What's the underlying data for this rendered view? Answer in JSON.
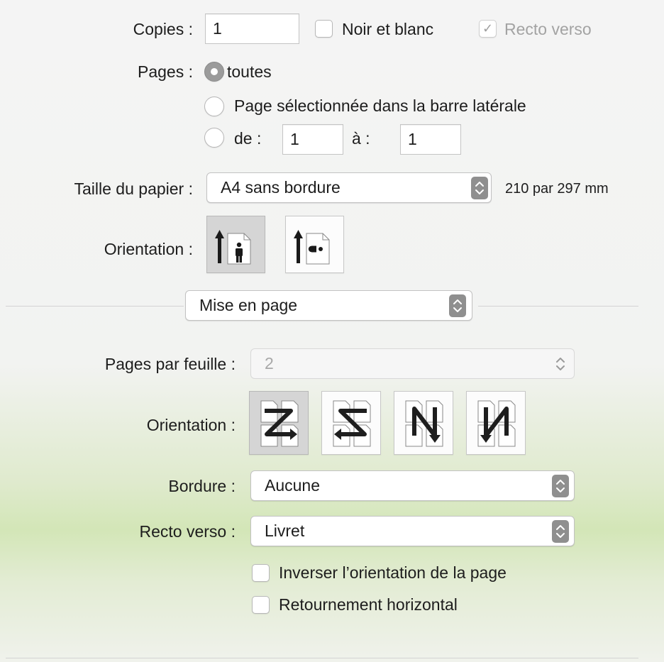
{
  "copies": {
    "label": "Copies :",
    "value": "1"
  },
  "noir_et_blanc": {
    "label": "Noir et blanc",
    "checked": false
  },
  "recto_verso_top": {
    "label": "Recto verso",
    "checked": true,
    "check_glyph": "✓"
  },
  "pages": {
    "label": "Pages :",
    "option_all": "toutes",
    "option_selected": "Page sélectionnée dans la barre latérale",
    "option_range": "de :",
    "range_from": "1",
    "range_to_label": "à :",
    "range_to": "1"
  },
  "paper_size": {
    "label": "Taille du papier :",
    "value": "A4 sans bordure",
    "dimensions": "210 par 297 mm"
  },
  "orientation": {
    "label": "Orientation :",
    "selected": "portrait",
    "icons": [
      "portrait-orientation-icon",
      "landscape-orientation-icon"
    ]
  },
  "section_popup": {
    "value": "Mise en page"
  },
  "layout": {
    "pages_per_sheet": {
      "label": "Pages par feuille :",
      "value": "2",
      "enabled": false
    },
    "direction": {
      "label": "Orientation :",
      "selected": 0,
      "icons": [
        "z-layout-icon",
        "reverse-z-layout-icon",
        "reverse-n-layout-icon",
        "n-layout-icon"
      ]
    },
    "border": {
      "label": "Bordure :",
      "value": "Aucune"
    },
    "two_sided": {
      "label": "Recto verso :",
      "value": "Livret"
    },
    "reverse_orientation": {
      "label": "Inverser l’orientation de la page",
      "checked": false
    },
    "flip_horizontal": {
      "label": "Retournement horizontal",
      "checked": false
    }
  },
  "colors": {
    "stepper": "#8f8f8f",
    "selected_button": "#d5d5d5",
    "text": "#1d1d1d",
    "disabled_text": "#a8a8a8"
  }
}
